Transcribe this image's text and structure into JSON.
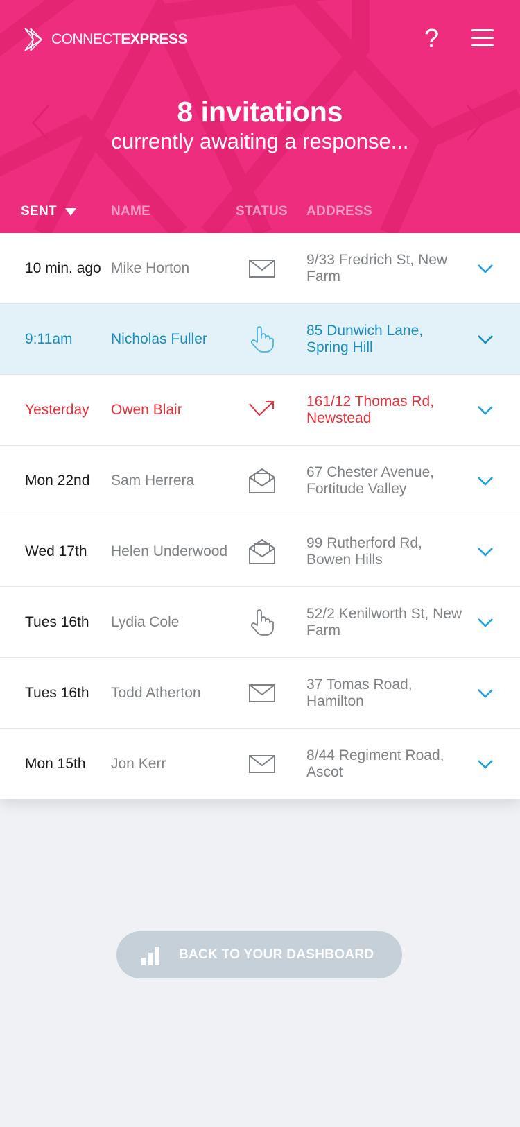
{
  "colors": {
    "brand": "#ef2d7f",
    "accent": "#1da3de",
    "alert": "#e8313a",
    "active_bg": "#e3f2f9"
  },
  "header": {
    "logo": {
      "thin": "CONNECT",
      "bold": "EXPRESS"
    },
    "help_icon": "?",
    "title": "8 invitations",
    "subtitle": "currently awaiting a response..."
  },
  "columns": {
    "sent": "SENT",
    "name": "NAME",
    "status": "STATUS",
    "address": "ADDRESS"
  },
  "rows": [
    {
      "sent": "10 min. ago",
      "name": "Mike Horton",
      "status": "envelope-icon",
      "address": "9/33 Fredrich St, New Farm",
      "state": "normal"
    },
    {
      "sent": "9:11am",
      "name": "Nicholas Fuller",
      "status": "hand-pointer-icon",
      "address": "85 Dunwich Lane, Spring Hill",
      "state": "active"
    },
    {
      "sent": "Yesterday",
      "name": "Owen Blair",
      "status": "bounce-arrow-icon",
      "address": "161/12 Thomas Rd, Newstead",
      "state": "urgent"
    },
    {
      "sent": "Mon 22nd",
      "name": "Sam Herrera",
      "status": "open-envelope-icon",
      "address": "67 Chester Avenue, Fortitude Valley",
      "state": "normal"
    },
    {
      "sent": "Wed 17th",
      "name": "Helen Underwood",
      "status": "open-envelope-icon",
      "address": "99 Rutherford Rd, Bowen Hills",
      "state": "normal"
    },
    {
      "sent": "Tues 16th",
      "name": "Lydia Cole",
      "status": "hand-pointer-icon",
      "address": "52/2 Kenilworth St, New Farm",
      "state": "normal"
    },
    {
      "sent": "Tues 16th",
      "name": "Todd Atherton",
      "status": "envelope-icon",
      "address": "37 Tomas Road, Hamilton",
      "state": "normal"
    },
    {
      "sent": "Mon 15th",
      "name": "Jon Kerr",
      "status": "envelope-icon",
      "address": "8/44 Regiment Road, Ascot",
      "state": "normal"
    }
  ],
  "dashboard_button": {
    "label": "BACK TO YOUR DASHBOARD",
    "icon": "bar-chart-icon"
  }
}
